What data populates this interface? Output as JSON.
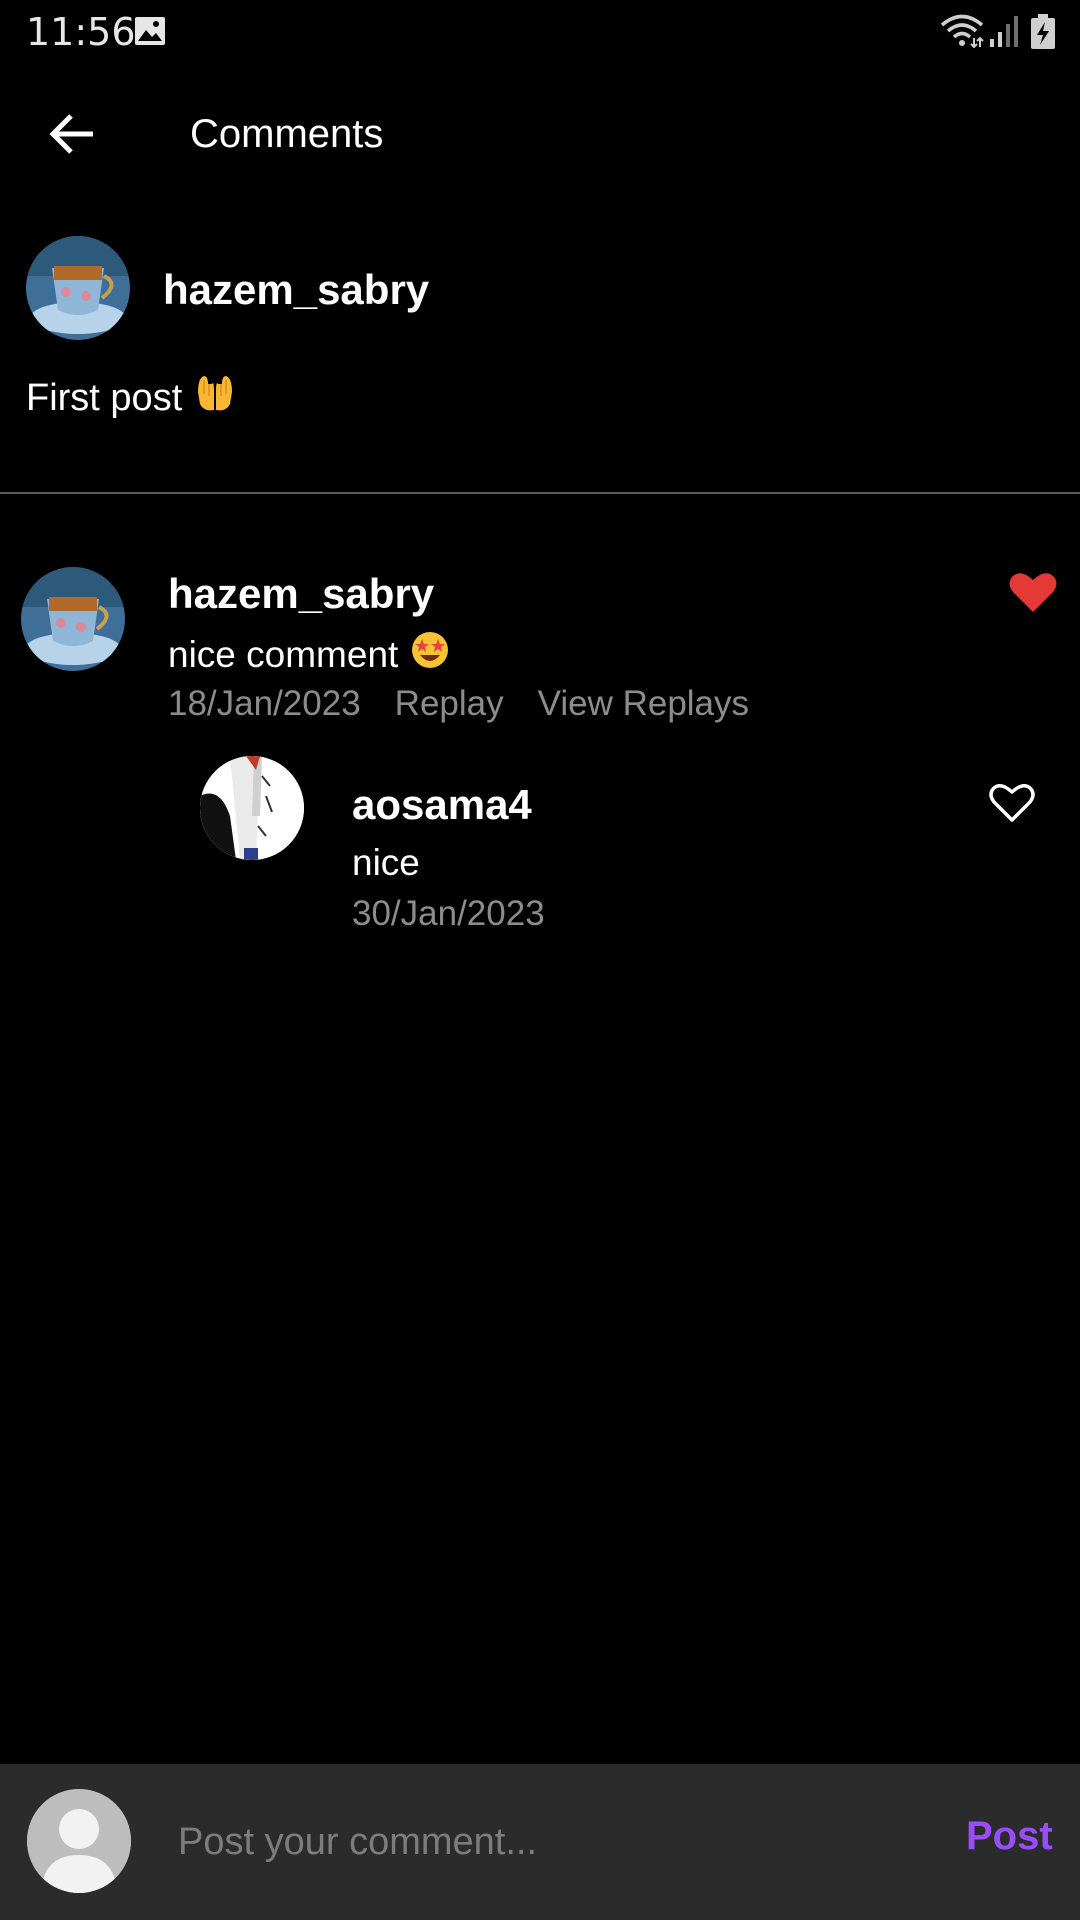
{
  "status_bar": {
    "time": "11:56",
    "icons": [
      "gallery-icon",
      "wifi-icon",
      "signal-icon",
      "battery-charging-icon"
    ]
  },
  "app_bar": {
    "title": "Comments",
    "back_icon": "arrow-left-icon"
  },
  "post": {
    "username": "hazem_sabry",
    "text": "First post",
    "emoji": "palms-up-together"
  },
  "comments": [
    {
      "username": "hazem_sabry",
      "text": "nice comment",
      "emoji": "star-struck",
      "date": "18/Jan/2023",
      "reply_label": "Replay",
      "view_replies_label": "View Replays",
      "liked": true,
      "like_color": "#e53935",
      "replies": [
        {
          "username": "aosama4",
          "text": "nice",
          "date": "30/Jan/2023",
          "liked": false
        }
      ]
    }
  ],
  "composer": {
    "placeholder": "Post your comment...",
    "value": "",
    "post_label": "Post",
    "post_color": "#9a4dff"
  },
  "colors": {
    "background": "#000000",
    "composer_bg": "#2b2b2b",
    "meta_text": "#8c8c8c",
    "divider": "#5a5a5a"
  }
}
